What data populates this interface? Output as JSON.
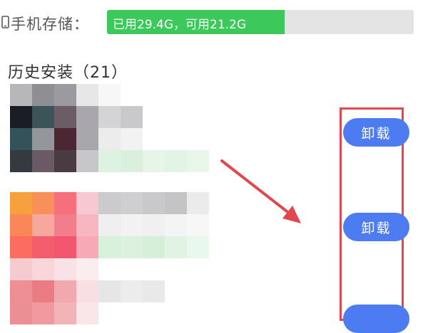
{
  "storage": {
    "label": "手机存储：",
    "bar_text": "已用29.4G，可用21.2G",
    "used_fraction": 0.58,
    "fill_color": "#3cc85b"
  },
  "history": {
    "title": "历史安装（21）"
  },
  "apps": [
    {
      "action_label": "卸载"
    },
    {
      "action_label": "卸载"
    },
    {
      "action_label": ""
    }
  ],
  "colors": {
    "accent_button": "#4d7cf2",
    "annotation_red": "#e0474f"
  },
  "icons": {
    "phone": "phone-icon"
  }
}
